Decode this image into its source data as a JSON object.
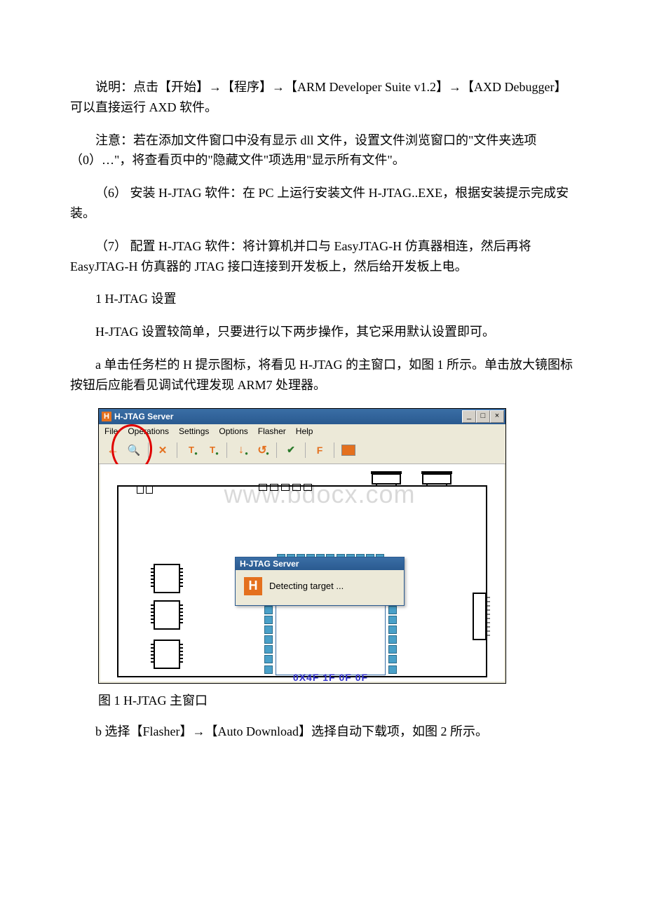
{
  "para1": "说明：点击【开始】→【程序】→【ARM Developer Suite v1.2】→【AXD Debugger】可以直接运行 AXD 软件。",
  "para2": "注意：若在添加文件窗口中没有显示 dll 文件，设置文件浏览窗口的\"文件夹选项（0）…\"，将查看页中的\"隐藏文件\"项选用\"显示所有文件\"。",
  "para3": "（6） 安装 H-JTAG 软件：在 PC 上运行安装文件 H-JTAG..EXE，根据安装提示完成安装。",
  "para4": "（7） 配置 H-JTAG 软件：将计算机并口与 EasyJTAG-H 仿真器相连，然后再将 EasyJTAG-H 仿真器的 JTAG 接口连接到开发板上，然后给开发板上电。",
  "para5": "1 H-JTAG 设置",
  "para6": "H-JTAG 设置较简单，只要进行以下两步操作，其它采用默认设置即可。",
  "para7": "a 单击任务栏的 H 提示图标，将看见 H-JTAG 的主窗口，如图 1 所示。单击放大镜图标按钮后应能看见调试代理发现 ARM7 处理器。",
  "caption1": "图 1 H-JTAG 主窗口",
  "para8": "b 选择【Flasher】→【Auto Download】选择自动下载项，如图 2 所示。",
  "screenshot": {
    "title_icon_letter": "H",
    "title": "H-JTAG Server",
    "winbtns": {
      "min": "_",
      "max": "□",
      "close": "×"
    },
    "menubar": [
      "File",
      "Operations",
      "Settings",
      "Options",
      "Flasher",
      "Help"
    ],
    "watermark": "www.bdocx.com",
    "detect": {
      "title": "H-JTAG Server",
      "icon_letter": "H",
      "msg": "Detecting target ..."
    },
    "cpu_id": "0X4F 1F 0F 0F"
  }
}
